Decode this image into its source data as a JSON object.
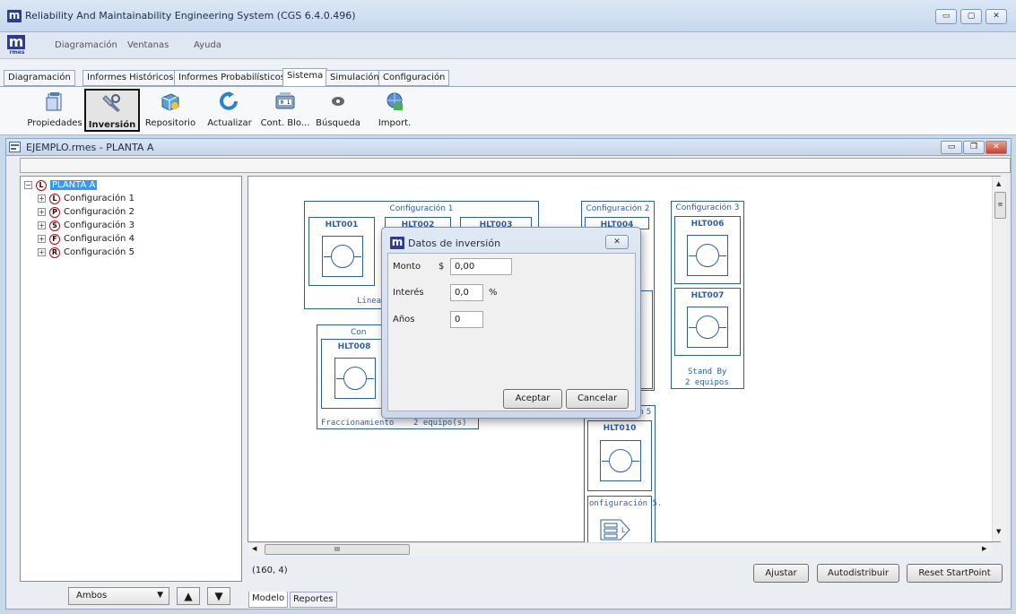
{
  "window": {
    "title": "Reliability And Maintainability Engineering System (CGS 6.4.0.496)",
    "app_icon": "m",
    "controls": [
      "minimize-icon",
      "maximize-icon",
      "close-icon"
    ]
  },
  "logo": {
    "mark": "m",
    "text": "rmes"
  },
  "menu": [
    "Diagramación",
    "Ventanas",
    "Ayuda"
  ],
  "tabs": [
    {
      "label": "Diagramación",
      "active": false
    },
    {
      "label": "Informes Históricos",
      "active": false
    },
    {
      "label": "Informes Probabilísticos",
      "active": false
    },
    {
      "label": "Sistema",
      "active": true
    },
    {
      "label": "Simulación",
      "active": false
    },
    {
      "label": "Configuración",
      "active": false
    }
  ],
  "ribbon": [
    {
      "label": "Propiedades",
      "icon": "properties-icon"
    },
    {
      "label": "Inversión",
      "icon": "investment-icon",
      "selected": true
    },
    {
      "label": "Repositorio",
      "icon": "repository-icon"
    },
    {
      "label": "Actualizar",
      "icon": "refresh-icon"
    },
    {
      "label": "Cont. Blo...",
      "icon": "block-counter-icon"
    },
    {
      "label": "Búsqueda",
      "icon": "search-icon"
    },
    {
      "label": "Import.",
      "icon": "import-icon"
    }
  ],
  "document": {
    "title": "EJEMPLO.rmes - PLANTA A"
  },
  "tree": {
    "root": {
      "label": "PLANTA A",
      "badge": "L"
    },
    "children": [
      {
        "label": "Configuración 1",
        "badge": "L"
      },
      {
        "label": "Configuración 2",
        "badge": "P"
      },
      {
        "label": "Configuración 3",
        "badge": "S"
      },
      {
        "label": "Configuración 4",
        "badge": "F"
      },
      {
        "label": "Configuración 5",
        "badge": "R"
      }
    ],
    "filter_value": "Ambos"
  },
  "canvas": {
    "groups": {
      "g1_title": "Configuración 1",
      "g1_footer": "Línea",
      "g2_title": "Configuración 2",
      "g3_title": "Configuración 3",
      "g3_footer1": "Stand By",
      "g3_footer2": "2 equipos",
      "g4_title": "Con",
      "g4_footer_left": "Fraccionamiento",
      "g4_footer_right": "2 equipo(s)",
      "g5_title": "n 5",
      "g5_sub": "onfiguración 5."
    },
    "components": {
      "hlt001": "HLT001",
      "hlt002": "HLT002",
      "hlt003": "HLT003",
      "hlt004": "HLT004",
      "hlt006": "HLT006",
      "hlt007": "HLT007",
      "hlt008": "HLT008",
      "hlt010": "HLT010"
    },
    "scroll_label": "III"
  },
  "dialog": {
    "title": "Datos de inversión",
    "monto_label": "Monto",
    "currency": "$",
    "monto_value": "0,00",
    "interes_label": "Interés",
    "interes_value": "0,0",
    "percent": "%",
    "anios_label": "Años",
    "anios_value": "0",
    "ok": "Aceptar",
    "cancel": "Cancelar"
  },
  "status": {
    "coords": "(160, 4)",
    "ajustar": "Ajustar",
    "autodistribuir": "Autodistribuir",
    "reset": "Reset StartPoint"
  },
  "bottom_tabs": [
    {
      "label": "Modelo",
      "active": true
    },
    {
      "label": "Reportes",
      "active": false
    }
  ]
}
